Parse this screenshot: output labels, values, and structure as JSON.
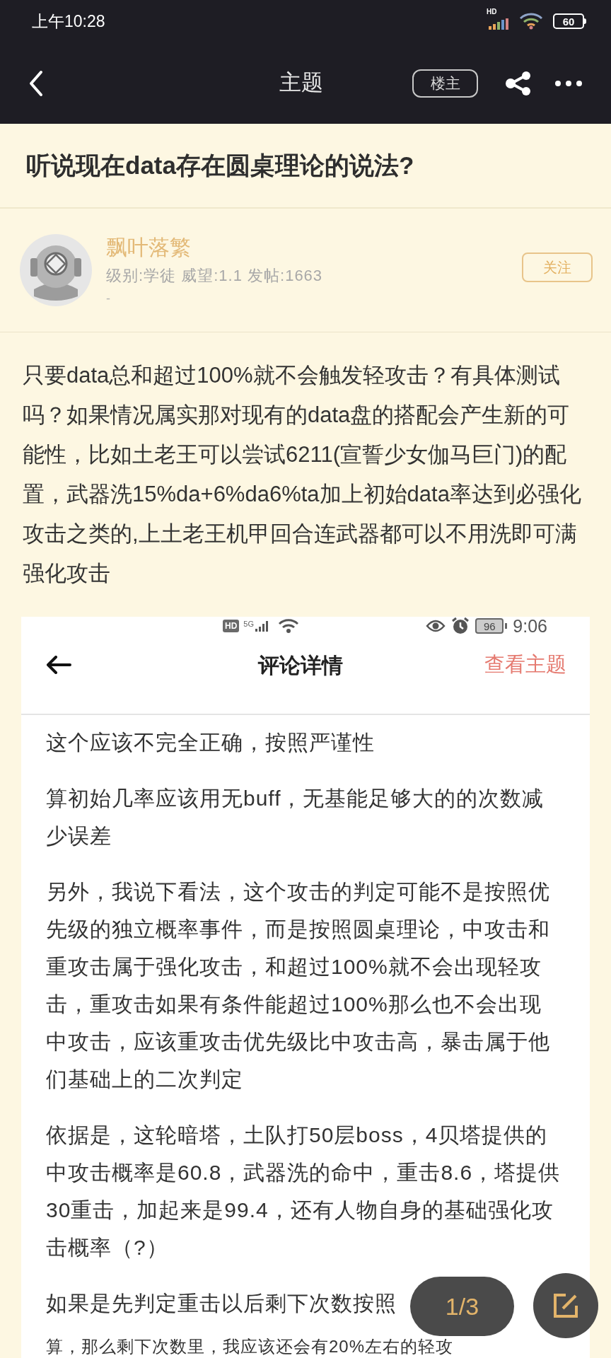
{
  "status_bar": {
    "time": "上午10:28",
    "network": "HD",
    "battery": "60"
  },
  "header": {
    "title": "主题",
    "op_button": "楼主"
  },
  "thread_title": "听说现在data存在圆桌理论的说法?",
  "author": {
    "name": "飘叶落繁",
    "meta": "级别:学徒 威望:1.1 发帖:1663",
    "signature": "-",
    "follow_button": "关注"
  },
  "body": "只要data总和超过100%就不会触发轻攻击？有具体测试吗？如果情况属实那对现有的data盘的搭配会产生新的可能性，比如土老王可以尝试6211(宣誓少女伽马巨门)的配置，武器洗15%da+6%da6%ta加上初始data率达到必强化攻击之类的,上土老王机甲回合连武器都可以不用洗即可满强化攻击",
  "embedded_screenshot": {
    "status_bar": {
      "hd": "HD",
      "network": "5G",
      "battery": "96",
      "time": "9:06"
    },
    "header": {
      "title": "评论详情",
      "action": "查看主题"
    },
    "paragraphs": [
      "这个应该不完全正确，按照严谨性",
      "算初始几率应该用无buff，无基能足够大的的次数减少误差",
      "另外，我说下看法，这个攻击的判定可能不是按照优先级的独立概率事件，而是按照圆桌理论，中攻击和重攻击属于强化攻击，和超过100%就不会出现轻攻击，重攻击如果有条件能超过100%那么也不会出现中攻击，应该重攻击优先级比中攻击高，暴击属于他们基础上的二次判定",
      "依据是，这轮暗塔，土队打50层boss，4贝塔提供的中攻击概率是60.8，武器洗的命中，重击8.6，塔提供30重击，加起来是99.4，还有人物自身的基础强化攻击概率（?）"
    ],
    "covered_paragraph_lines": [
      "如果是先判定重击以后剩下次数按照",
      "算，那么剩下次数里，我应该还会有20%左右的轻攻"
    ]
  },
  "pager": "1/3"
}
